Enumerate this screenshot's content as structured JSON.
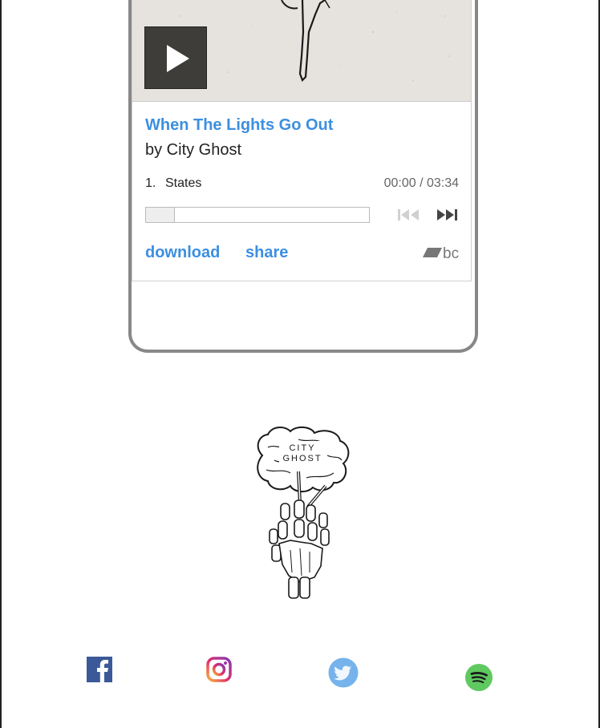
{
  "player": {
    "track_title": "When The Lights Go Out",
    "artist": "by City Ghost",
    "track_number": "1.",
    "track_name": "States",
    "time": "00:00 / 03:34",
    "progress": 0,
    "download_label": "download",
    "share_label": "share",
    "brand": "bc",
    "accent_color": "#3d8fe0"
  },
  "logo": {
    "line1": "CITY",
    "line2": "GHOST"
  },
  "social": [
    {
      "name": "facebook",
      "color": "#3b5998"
    },
    {
      "name": "instagram",
      "color": "#c13584"
    },
    {
      "name": "twitter",
      "color": "#76b3ec"
    },
    {
      "name": "spotify",
      "color": "#5fc95f"
    }
  ]
}
